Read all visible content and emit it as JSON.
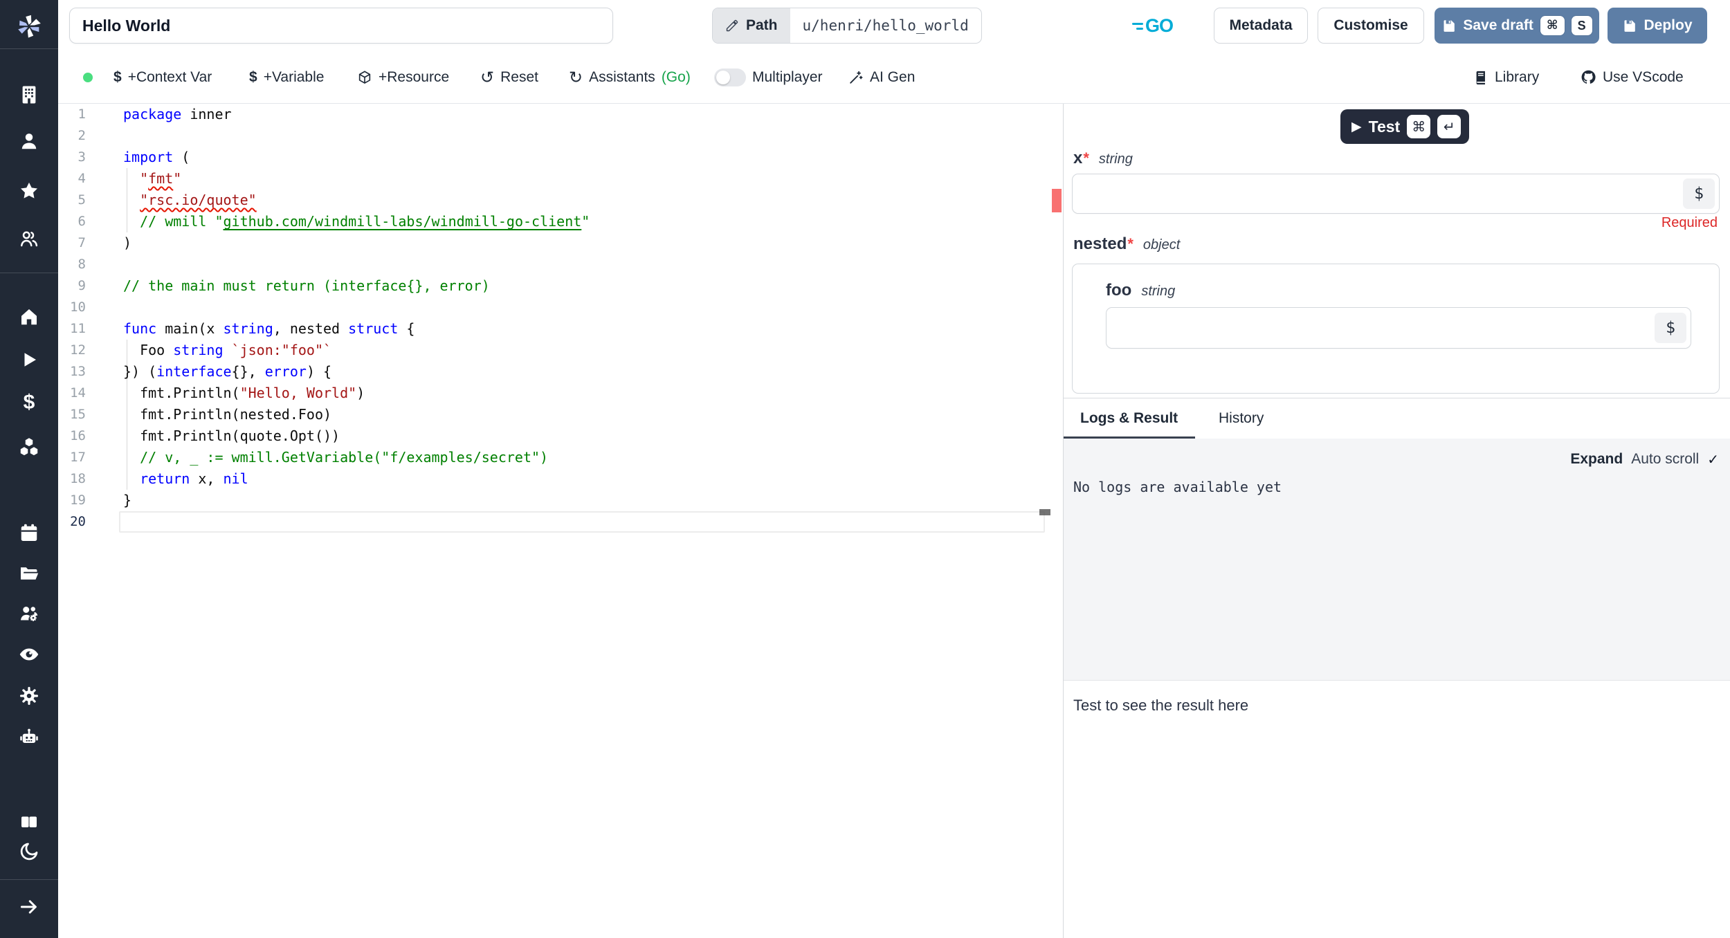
{
  "topbar": {
    "title_value": "Hello World",
    "path_label": "Path",
    "path_value": "u/henri/hello_world",
    "language": "GO",
    "metadata": "Metadata",
    "customise": "Customise",
    "save_draft": "Save draft",
    "save_kbd": [
      "⌘",
      "S"
    ],
    "deploy": "Deploy"
  },
  "toolbar": {
    "dollar": "$",
    "context_var": "+Context Var",
    "variable": "+Variable",
    "resource": "+Resource",
    "reset_icon": "↺",
    "reset": "Reset",
    "assistants_icon": "↻",
    "assistants": "Assistants",
    "assistants_lang": "(Go)",
    "multiplayer": "Multiplayer",
    "ai_gen": "AI Gen",
    "library": "Library",
    "use_vscode": "Use VScode"
  },
  "editor": {
    "lines": [
      {
        "n": 1,
        "tokens": [
          [
            "k",
            "package"
          ],
          [
            "d",
            " inner"
          ]
        ]
      },
      {
        "n": 2,
        "tokens": []
      },
      {
        "n": 3,
        "tokens": [
          [
            "k",
            "import"
          ],
          [
            "d",
            " ("
          ]
        ]
      },
      {
        "n": 4,
        "tokens": [
          [
            "d",
            "  "
          ],
          [
            "s",
            "\""
          ],
          [
            "sw",
            "fmt"
          ],
          [
            "s",
            "\""
          ]
        ]
      },
      {
        "n": 5,
        "tokens": [
          [
            "d",
            "  "
          ],
          [
            "sw",
            "\"rsc.io/quote\""
          ]
        ]
      },
      {
        "n": 6,
        "tokens": [
          [
            "d",
            "  "
          ],
          [
            "c",
            "// wmill \""
          ],
          [
            "cl",
            "github.com/windmill-labs/windmill-go-client"
          ],
          [
            "c",
            "\""
          ]
        ]
      },
      {
        "n": 7,
        "tokens": [
          [
            "d",
            ")"
          ]
        ]
      },
      {
        "n": 8,
        "tokens": []
      },
      {
        "n": 9,
        "tokens": [
          [
            "c",
            "// the main must return (interface{}, error)"
          ]
        ]
      },
      {
        "n": 10,
        "tokens": []
      },
      {
        "n": 11,
        "tokens": [
          [
            "k",
            "func"
          ],
          [
            "d",
            " main(x "
          ],
          [
            "k",
            "string"
          ],
          [
            "d",
            ", nested "
          ],
          [
            "k",
            "struct"
          ],
          [
            "d",
            " {"
          ]
        ]
      },
      {
        "n": 12,
        "tokens": [
          [
            "d",
            "  Foo "
          ],
          [
            "k",
            "string"
          ],
          [
            "d",
            " "
          ],
          [
            "s",
            "`json:\"foo\"`"
          ]
        ]
      },
      {
        "n": 13,
        "tokens": [
          [
            "d",
            "}) ("
          ],
          [
            "k",
            "interface"
          ],
          [
            "d",
            "{}, "
          ],
          [
            "k",
            "error"
          ],
          [
            "d",
            ") {"
          ]
        ]
      },
      {
        "n": 14,
        "tokens": [
          [
            "d",
            "  fmt.Println("
          ],
          [
            "s",
            "\"Hello, World\""
          ],
          [
            "d",
            ")"
          ]
        ]
      },
      {
        "n": 15,
        "tokens": [
          [
            "d",
            "  fmt.Println(nested.Foo)"
          ]
        ]
      },
      {
        "n": 16,
        "tokens": [
          [
            "d",
            "  fmt.Println(quote.Opt())"
          ]
        ]
      },
      {
        "n": 17,
        "tokens": [
          [
            "c",
            "  // v, _ := wmill.GetVariable(\"f/examples/secret\")"
          ]
        ]
      },
      {
        "n": 18,
        "tokens": [
          [
            "d",
            "  "
          ],
          [
            "k",
            "return"
          ],
          [
            "d",
            " x, "
          ],
          [
            "k",
            "nil"
          ]
        ]
      },
      {
        "n": 19,
        "tokens": [
          [
            "d",
            "}"
          ]
        ]
      },
      {
        "n": 20,
        "tokens": [],
        "active": true
      }
    ]
  },
  "panel": {
    "test": "Test",
    "test_play": "▶",
    "test_kbd": [
      "⌘",
      "↵"
    ],
    "args": {
      "x_name": "x",
      "x_type": "string",
      "nested_name": "nested",
      "nested_type": "object",
      "foo_name": "foo",
      "foo_type": "string",
      "star": "*",
      "dollar": "$",
      "required": "Required"
    },
    "tabs": {
      "logs": "Logs & Result",
      "history": "History"
    },
    "logs": {
      "expand": "Expand",
      "autoscroll": "Auto scroll",
      "check": "✓",
      "empty": "No logs are available yet"
    },
    "result_placeholder": "Test to see the result here"
  },
  "colors": {
    "sidebar_bg": "#212936",
    "slate_button": "#5d7ea6",
    "go_cyan": "#00acd7",
    "keyword_blue": "#0000ff",
    "string_red": "#a31515",
    "comment_green": "#008000",
    "error_marker": "#f87171",
    "required_red": "#dc2626",
    "green_dot": "#4ade80"
  }
}
